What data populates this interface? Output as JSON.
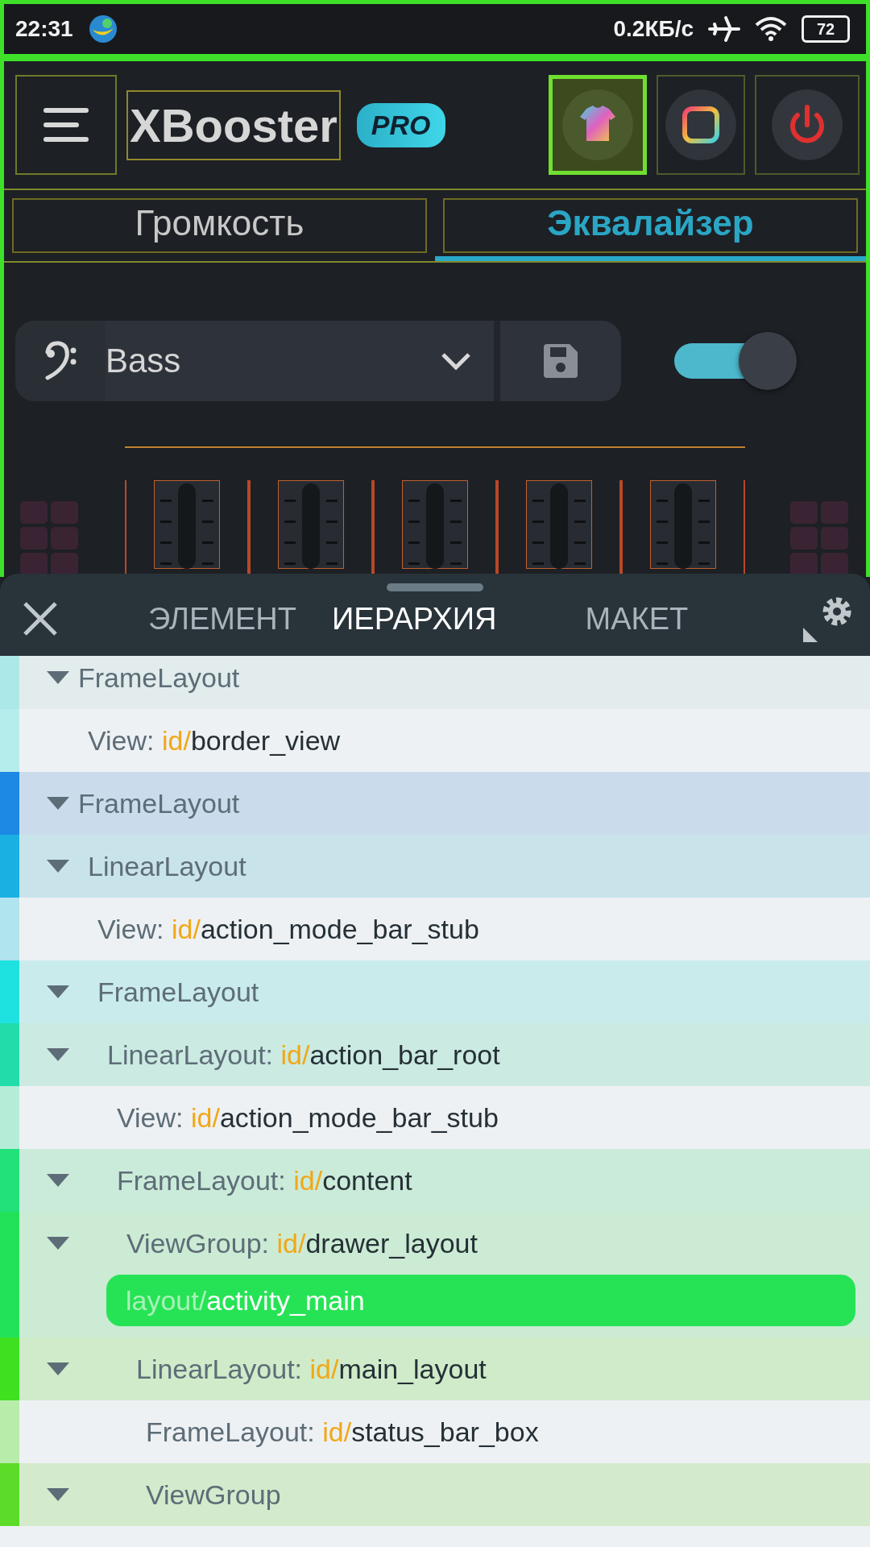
{
  "status_bar": {
    "time": "22:31",
    "speed": "0.2КБ/с",
    "battery": "72"
  },
  "app": {
    "title": "XBooster",
    "badge": "PRO",
    "header_buttons": [
      {
        "kind": "theme",
        "highlighted": true
      },
      {
        "kind": "frame",
        "highlighted": false
      },
      {
        "kind": "power",
        "highlighted": false
      }
    ],
    "tabs": [
      {
        "label": "Громкость",
        "selected": false
      },
      {
        "label": "Эквалайзер",
        "selected": true
      }
    ],
    "preset": {
      "value": "Bass"
    },
    "switch": {
      "on": true
    }
  },
  "inspector": {
    "tabs": [
      {
        "label": "ЭЛЕМЕНТ",
        "selected": false
      },
      {
        "label": "ИЕРАРХИЯ",
        "selected": true
      },
      {
        "label": "МАКЕТ",
        "selected": false
      }
    ],
    "tree": [
      {
        "type": "FrameLayout",
        "color": "#ade8e8",
        "expanded": true,
        "children": [
          {
            "type": "View:",
            "ns": "id/",
            "id": "border_view",
            "color": "#b5ecec"
          }
        ]
      },
      {
        "type": "FrameLayout",
        "color": "#1e88e5",
        "expanded": true,
        "children": [
          {
            "type": "LinearLayout",
            "color": "#1ab0e2",
            "expanded": true,
            "children": [
              {
                "type": "View:",
                "ns": "id/",
                "id": "action_mode_bar_stub",
                "color": "#b0e4ee"
              },
              {
                "type": "FrameLayout",
                "color": "#1ee2e0",
                "expanded": true,
                "children": [
                  {
                    "type": "LinearLayout:",
                    "ns": "id/",
                    "id": "action_bar_root",
                    "color": "#22dcaa",
                    "expanded": true,
                    "children": [
                      {
                        "type": "View:",
                        "ns": "id/",
                        "id": "action_mode_bar_stub",
                        "color": "#b5ecd8"
                      },
                      {
                        "type": "FrameLayout:",
                        "ns": "id/",
                        "id": "content",
                        "color": "#22e07a",
                        "expanded": true,
                        "children": [
                          {
                            "type": "ViewGroup:",
                            "ns": "id/",
                            "id": "drawer_layout",
                            "color": "#22e25a",
                            "expanded": true,
                            "layout_prefix": "layout/",
                            "layout": "activity_main",
                            "children": [
                              {
                                "type": "LinearLayout:",
                                "ns": "id/",
                                "id": "main_layout",
                                "color": "#3ee020",
                                "expanded": true,
                                "children": [
                                  {
                                    "type": "FrameLayout:",
                                    "ns": "id/",
                                    "id": "status_bar_box",
                                    "color": "#b8ecaa"
                                  },
                                  {
                                    "type": "ViewGroup",
                                    "color": "#5cdc28",
                                    "expanded": true
                                  }
                                ]
                              }
                            ]
                          }
                        ]
                      }
                    ]
                  }
                ]
              }
            ]
          }
        ]
      }
    ]
  }
}
